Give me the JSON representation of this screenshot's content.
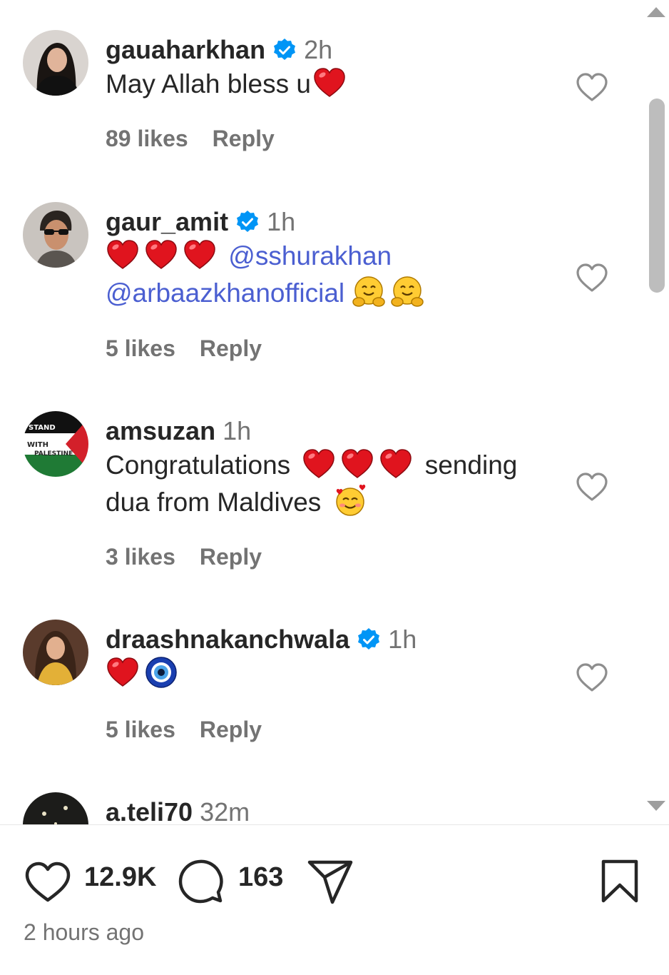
{
  "comments": [
    {
      "username": "gauaharkhan",
      "verified": true,
      "time": "2h",
      "text_parts": [
        "May Allah bless u"
      ],
      "emojis_after": [
        "red-heart"
      ],
      "likes": "89 likes",
      "reply": "Reply"
    },
    {
      "username": "gaur_amit",
      "verified": true,
      "time": "1h",
      "mention1": "@sshurakhan",
      "mention2": "@arbaazkhanofficial",
      "emojis": [
        "red-heart",
        "red-heart",
        "red-heart",
        "hugging-face",
        "hugging-face"
      ],
      "likes": "5 likes",
      "reply": "Reply"
    },
    {
      "username": "amsuzan",
      "verified": false,
      "time": "1h",
      "text_part1": "Congratulations",
      "text_part2": "sending",
      "text_part3": "dua from Maldives",
      "emojis": [
        "red-heart",
        "red-heart",
        "red-heart",
        "smiling-face-with-hearts"
      ],
      "avatar_text_1": "STAND",
      "avatar_text_2": "WITH",
      "avatar_text_3": "PALESTINE",
      "likes": "3 likes",
      "reply": "Reply"
    },
    {
      "username": "draashnakanchwala",
      "verified": true,
      "time": "1h",
      "emojis": [
        "red-heart",
        "nazar-amulet"
      ],
      "likes": "5 likes",
      "reply": "Reply"
    },
    {
      "username": "a.teli70",
      "verified": false,
      "time": "32m"
    }
  ],
  "actions": {
    "like_count": "12.9K",
    "comment_count": "163",
    "icons": [
      "heart-icon",
      "comment-icon",
      "share-icon",
      "bookmark-icon"
    ]
  },
  "post_time": "2 hours ago",
  "colors": {
    "text": "#262626",
    "secondary": "#737373",
    "mention": "#4b5fd1",
    "verified": "#0095f6",
    "heart": "#e0141e"
  }
}
